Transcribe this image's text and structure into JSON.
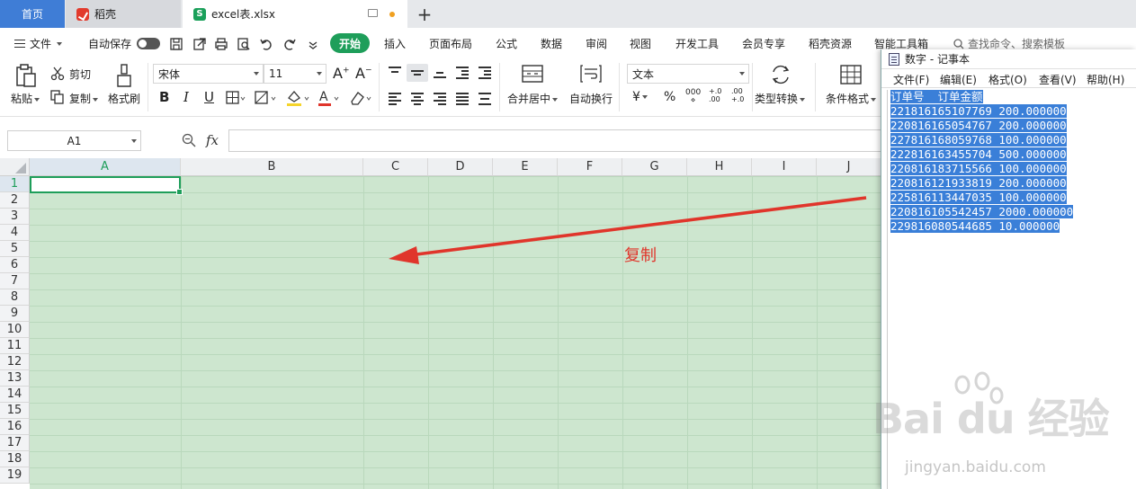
{
  "tabs": {
    "home": "首页",
    "docer": "稻壳",
    "file": "excel表.xlsx"
  },
  "menubar": {
    "file": "文件",
    "autosave": "自动保存",
    "start": "开始",
    "items": [
      "插入",
      "页面布局",
      "公式",
      "数据",
      "审阅",
      "视图",
      "开发工具",
      "会员专享",
      "稻壳资源",
      "智能工具箱"
    ],
    "search": "查找命令、搜索模板"
  },
  "ribbon": {
    "paste": "粘贴",
    "cut": "剪切",
    "copy": "复制",
    "format_painter": "格式刷",
    "font_name": "宋体",
    "font_size": "11",
    "bold": "B",
    "italic": "I",
    "underline": "U",
    "merge_center": "合并居中",
    "wrap_text": "自动换行",
    "number_format": "文本",
    "currency": "¥",
    "percent": "%",
    "thousands": "000",
    "inc_decimal": "+.0 .00",
    "dec_decimal": ".00 +.0",
    "type_convert": "类型转换",
    "conditional_format": "条件格式"
  },
  "formula_bar": {
    "cell_ref": "A1",
    "fx": "fx",
    "value": ""
  },
  "grid": {
    "columns": [
      "A",
      "B",
      "C",
      "D",
      "E",
      "F",
      "G",
      "H",
      "I",
      "J"
    ],
    "rows": [
      "1",
      "2",
      "3",
      "4",
      "5",
      "6",
      "7",
      "8",
      "9",
      "10",
      "11",
      "12",
      "13",
      "14",
      "15",
      "16",
      "17",
      "18",
      "19"
    ],
    "active_column": "A",
    "active_row": "1",
    "annotation": "复制"
  },
  "notepad": {
    "title": "数字 - 记事本",
    "menu": [
      "文件(F)",
      "编辑(E)",
      "格式(O)",
      "查看(V)",
      "帮助(H)"
    ],
    "lines": [
      "订单号  订单金额",
      "221816165107769 200.000000",
      "220816165054767 200.000000",
      "227816168059768 100.000000",
      "222816163455704 500.000000",
      "220816183715566 100.000000",
      "220816121933819 200.000000",
      "225816113447035 100.000000",
      "220816105542457 2000.000000",
      "229816080544685 10.000000"
    ]
  },
  "watermark": {
    "brand": "Bai du 经验",
    "url": "jingyan.baidu.com"
  },
  "colors": {
    "accent_green": "#1e9e5a",
    "home_tab_blue": "#3f7dd6",
    "selection_blue": "#3a7fd8",
    "arrow_red": "#e0352b",
    "sheet_bg": "#cde6cf"
  }
}
